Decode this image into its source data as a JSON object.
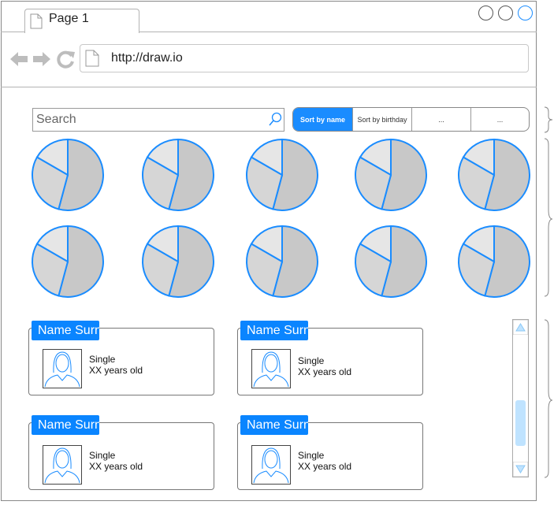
{
  "browser": {
    "tab_label": "Page 1",
    "url": "http://draw.io"
  },
  "search": {
    "placeholder": "Search"
  },
  "sort_options": [
    "Sort by name",
    "Sort by birthday",
    "...",
    "..."
  ],
  "pie_chart_count": 10,
  "people": [
    {
      "name": "Name Surname",
      "status": "Single",
      "age": "XX years old"
    },
    {
      "name": "Name Surname",
      "status": "Single",
      "age": "XX years old"
    },
    {
      "name": "Name Surname",
      "status": "Single",
      "age": "XX years old"
    },
    {
      "name": "Name Surname",
      "status": "Single",
      "age": "XX years old"
    }
  ],
  "colors": {
    "accent": "#1a8cff",
    "pie_stroke": "#1a8cff",
    "pie_fill_dark": "#c8c8c8",
    "pie_fill_mid": "#d6d6d6",
    "pie_fill_light": "#e6e6e6"
  }
}
